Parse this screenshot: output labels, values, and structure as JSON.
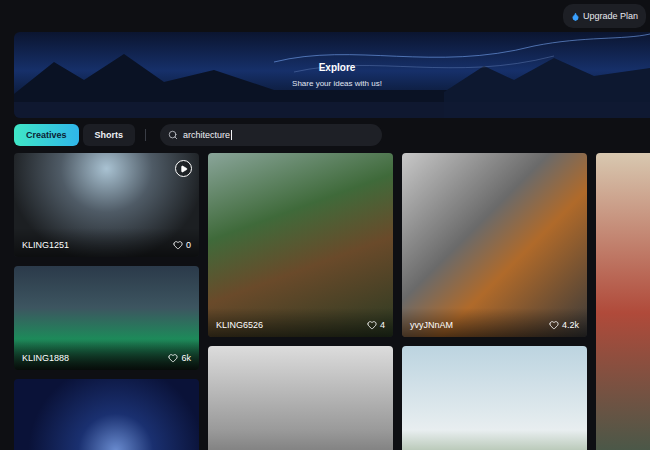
{
  "header": {
    "upgrade_button": "Upgrade Plan"
  },
  "banner": {
    "title": "Explore",
    "subtitle": "Share your ideas with us!"
  },
  "tabs": [
    {
      "label": "Creatives",
      "selected": true
    },
    {
      "label": "Shorts",
      "selected": false
    }
  ],
  "search": {
    "value": "architecture"
  },
  "feed": {
    "columns": [
      {
        "cards": [
          {
            "author": "KLING1251",
            "likes": "0",
            "video": true
          },
          {
            "author": "KLING1888",
            "likes": "6k",
            "video": false
          },
          {
            "video": false
          }
        ]
      },
      {
        "cards": [
          {
            "author": "KLING6526",
            "likes": "4",
            "video": false
          },
          {
            "video": false
          }
        ]
      },
      {
        "cards": [
          {
            "author": "yvyJNnAM",
            "likes": "4.2k",
            "video": false
          },
          {
            "video": false
          }
        ]
      },
      {
        "cards": [
          {
            "video": false
          }
        ]
      }
    ]
  }
}
